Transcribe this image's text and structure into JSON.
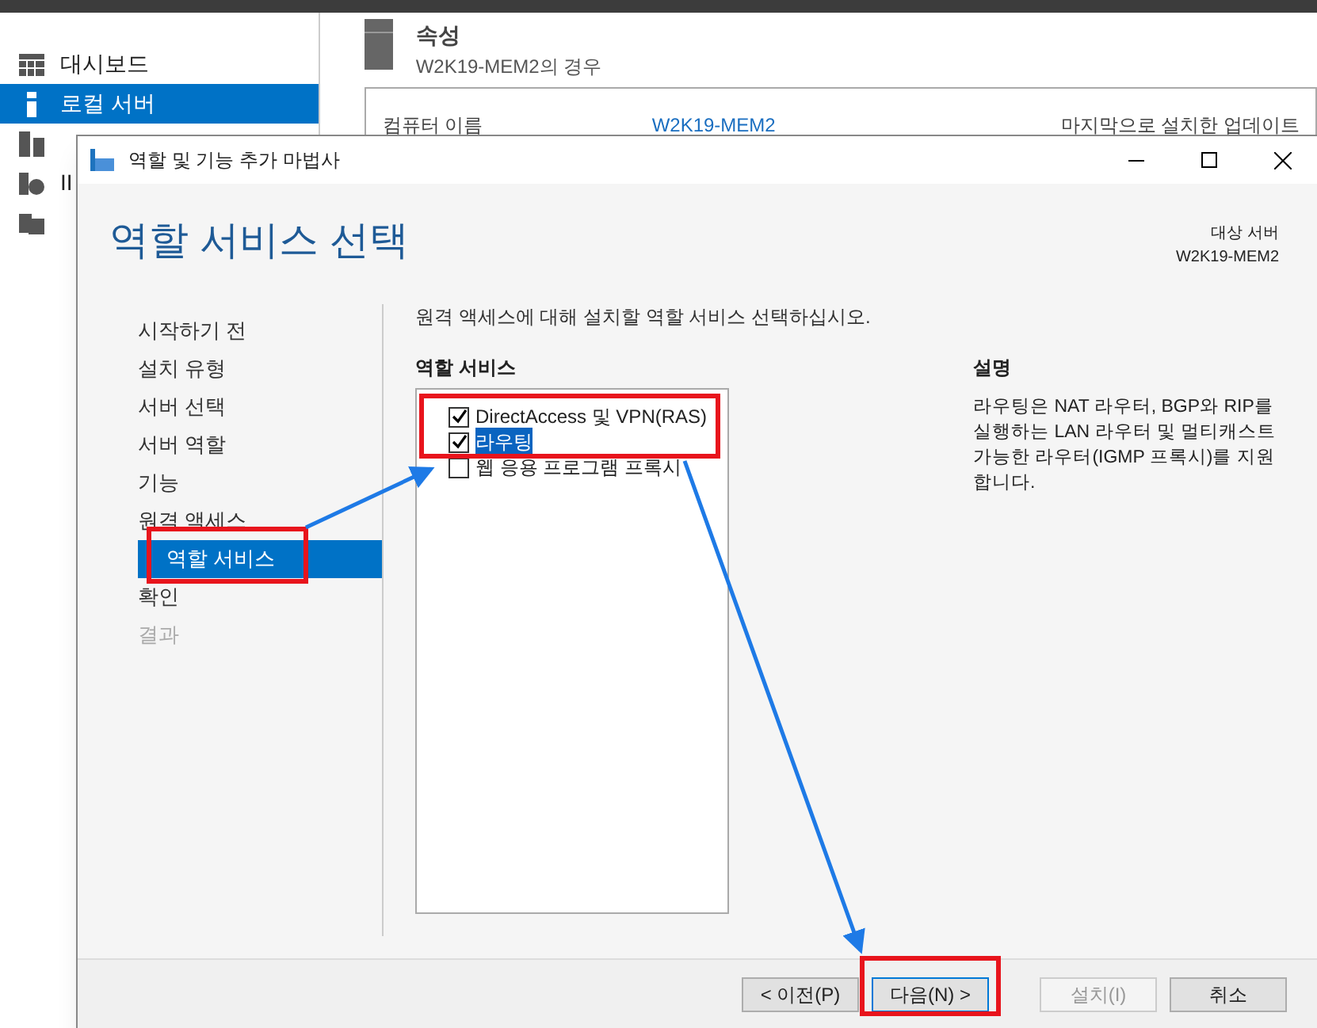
{
  "background": {
    "sidebar": {
      "items": [
        {
          "label": "대시보드",
          "selected": false
        },
        {
          "label": "로컬 서버",
          "selected": true
        },
        {
          "selected": false
        },
        {
          "label": "II",
          "selected": false
        },
        {
          "selected": false
        }
      ]
    },
    "header": {
      "title": "속성",
      "subtitle": "W2K19-MEM2의 경우"
    },
    "properties": {
      "label": "컴퓨터 이름",
      "value": "W2K19-MEM2",
      "column_3": "마지막으로 설치한 업데이트"
    }
  },
  "dialog": {
    "title": "역할 및 기능 추가 마법사",
    "heading": "역할 서비스 선택",
    "target_label": "대상 서버",
    "target_server": "W2K19-MEM2",
    "steps": [
      {
        "label": "시작하기 전",
        "selected": false,
        "disabled": false,
        "indented": false
      },
      {
        "label": "설치 유형",
        "selected": false,
        "disabled": false,
        "indented": false
      },
      {
        "label": "서버 선택",
        "selected": false,
        "disabled": false,
        "indented": false
      },
      {
        "label": "서버 역할",
        "selected": false,
        "disabled": false,
        "indented": false
      },
      {
        "label": "기능",
        "selected": false,
        "disabled": false,
        "indented": false
      },
      {
        "label": "원격 액세스",
        "selected": false,
        "disabled": false,
        "indented": false
      },
      {
        "label": "역할 서비스",
        "selected": true,
        "disabled": false,
        "indented": true
      },
      {
        "label": "확인",
        "selected": false,
        "disabled": false,
        "indented": false
      },
      {
        "label": "결과",
        "selected": false,
        "disabled": true,
        "indented": false
      }
    ],
    "instruction": "원격 액세스에 대해 설치할 역할 서비스 선택하십시오.",
    "list_title": "역할 서비스",
    "services": [
      {
        "label": "DirectAccess 및 VPN(RAS)",
        "checked": true,
        "selected": false
      },
      {
        "label": "라우팅",
        "checked": true,
        "selected": true
      },
      {
        "label": "웹 응용 프로그램 프록시",
        "checked": false,
        "selected": false
      }
    ],
    "description_title": "설명",
    "description": "라우팅은 NAT 라우터, BGP와 RIP를 실행하는 LAN 라우터 및 멀티캐스트 가능한 라우터(IGMP 프록시)를 지원합니다.",
    "buttons": [
      {
        "label": "< 이전(P)",
        "disabled": false,
        "focused": false
      },
      {
        "label": "다음(N) >",
        "disabled": false,
        "focused": true
      },
      {
        "label": "설치(I)",
        "disabled": true,
        "focused": false
      },
      {
        "label": "취소",
        "disabled": false,
        "focused": false
      }
    ]
  }
}
